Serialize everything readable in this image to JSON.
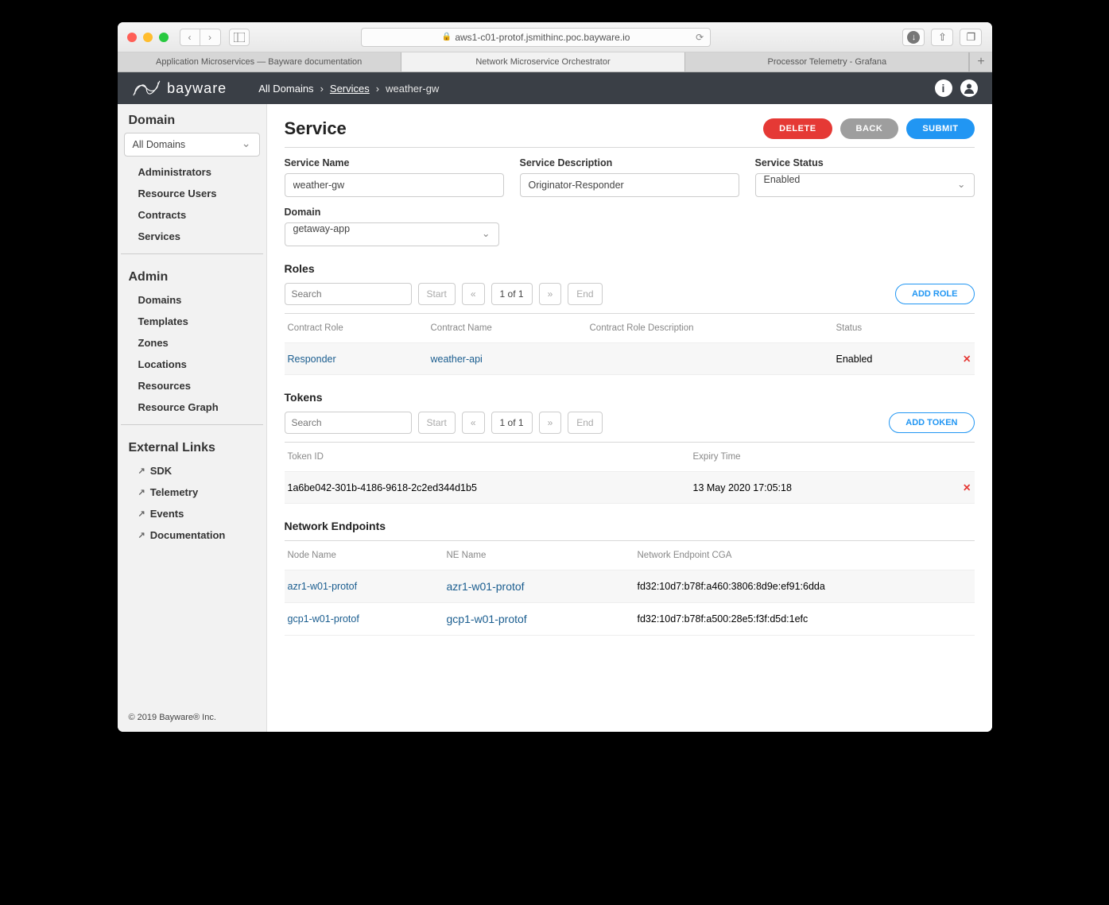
{
  "browser": {
    "url": "aws1-c01-protof.jsmithinc.poc.bayware.io",
    "tabs": [
      "Application Microservices — Bayware documentation",
      "Network Microservice Orchestrator",
      "Processor Telemetry - Grafana"
    ],
    "active_tab": 1
  },
  "header": {
    "brand": "bayware",
    "breadcrumb": [
      "All Domains",
      "Services",
      "weather-gw"
    ]
  },
  "sidebar": {
    "domain_title": "Domain",
    "domain_select": "All Domains",
    "domain_items": [
      "Administrators",
      "Resource Users",
      "Contracts",
      "Services"
    ],
    "admin_title": "Admin",
    "admin_items": [
      "Domains",
      "Templates",
      "Zones",
      "Locations",
      "Resources",
      "Resource Graph"
    ],
    "ext_title": "External Links",
    "ext_items": [
      "SDK",
      "Telemetry",
      "Events",
      "Documentation"
    ],
    "footer": "© 2019 Bayware® Inc."
  },
  "page": {
    "title": "Service",
    "buttons": {
      "delete": "DELETE",
      "back": "BACK",
      "submit": "SUBMIT"
    },
    "fields": {
      "service_name": {
        "label": "Service Name",
        "value": "weather-gw"
      },
      "service_description": {
        "label": "Service Description",
        "value": "Originator-Responder"
      },
      "service_status": {
        "label": "Service Status",
        "value": "Enabled"
      },
      "domain": {
        "label": "Domain",
        "value": "getaway-app"
      }
    },
    "roles": {
      "title": "Roles",
      "search_placeholder": "Search",
      "start": "Start",
      "end": "End",
      "page": "1 of 1",
      "add": "ADD ROLE",
      "columns": [
        "Contract Role",
        "Contract Name",
        "Contract Role Description",
        "Status"
      ],
      "rows": [
        {
          "role": "Responder",
          "name": "weather-api",
          "desc": "",
          "status": "Enabled"
        }
      ]
    },
    "tokens": {
      "title": "Tokens",
      "search_placeholder": "Search",
      "start": "Start",
      "end": "End",
      "page": "1 of 1",
      "add": "ADD TOKEN",
      "columns": [
        "Token ID",
        "Expiry Time"
      ],
      "rows": [
        {
          "id": "1a6be042-301b-4186-9618-2c2ed344d1b5",
          "expiry": "13 May 2020 17:05:18"
        }
      ]
    },
    "endpoints": {
      "title": "Network Endpoints",
      "columns": [
        "Node Name",
        "NE Name",
        "Network Endpoint CGA"
      ],
      "rows": [
        {
          "node": "azr1-w01-protof",
          "ne": "azr1-w01-protof",
          "cga": "fd32:10d7:b78f:a460:3806:8d9e:ef91:6dda"
        },
        {
          "node": "gcp1-w01-protof",
          "ne": "gcp1-w01-protof",
          "cga": "fd32:10d7:b78f:a500:28e5:f3f:d5d:1efc"
        }
      ]
    }
  }
}
